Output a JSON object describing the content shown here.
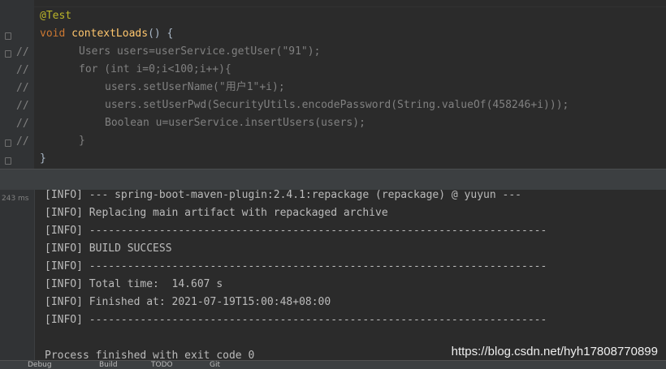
{
  "editor": {
    "gutter_marks": [
      "//",
      "//",
      "//",
      "//",
      "//",
      "//"
    ],
    "lines": {
      "annotation": "@Test",
      "sig_void": "void",
      "sig_name": "contextLoads",
      "sig_rest": "() {",
      "l1": "Users users=userService.getUser(\"91\");",
      "l2": "for (int i=0;i<100;i++){",
      "l3": "users.setUserName(\"用户1\"+i);",
      "l4": "users.setUserPwd(SecurityUtils.encodePassword(String.valueOf(458246+i)));",
      "l5": "Boolean u=userService.insertUsers(users);",
      "l6": "}",
      "l7": "}"
    }
  },
  "console": {
    "elapsed": "243 ms",
    "lines": [
      "[INFO] --- spring-boot-maven-plugin:2.4.1:repackage (repackage) @ yuyun ---",
      "[INFO] Replacing main artifact with repackaged archive",
      "[INFO] ------------------------------------------------------------------------",
      "[INFO] BUILD SUCCESS",
      "[INFO] ------------------------------------------------------------------------",
      "[INFO] Total time:  14.607 s",
      "[INFO] Finished at: 2021-07-19T15:00:48+08:00",
      "[INFO] ------------------------------------------------------------------------",
      "",
      "Process finished with exit code 0"
    ]
  },
  "watermark": "https://blog.csdn.net/hyh17808770899",
  "statusbar": {
    "items": [
      "Debug",
      "Build",
      "TODO",
      "Git"
    ]
  },
  "colors": {
    "background": "#2b2b2b",
    "keyword": "#cc7832",
    "method": "#ffc66d",
    "annotation": "#bbb529",
    "comment": "#808080"
  }
}
